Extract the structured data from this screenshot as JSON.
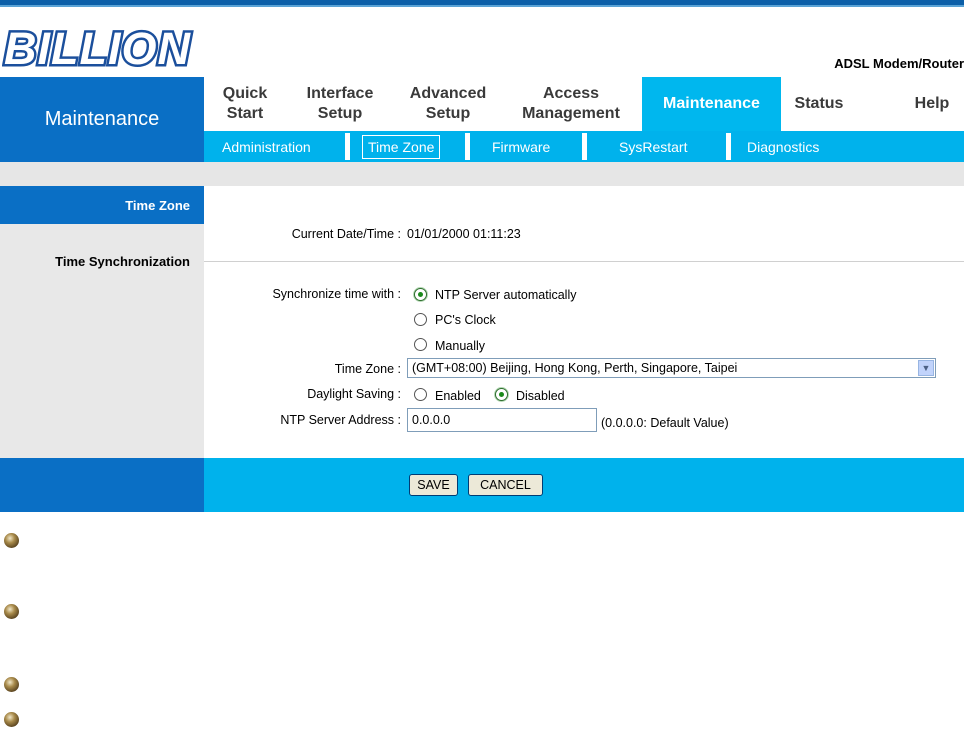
{
  "header": {
    "logo_text": "BILLION",
    "product": "ADSL Modem/Router"
  },
  "nav": {
    "section_title": "Maintenance",
    "items": [
      {
        "label": "Quick\nStart"
      },
      {
        "label": "Interface\nSetup"
      },
      {
        "label": "Advanced\nSetup"
      },
      {
        "label": "Access\nManagement"
      },
      {
        "label": "Maintenance"
      },
      {
        "label": "Status"
      },
      {
        "label": "Help"
      }
    ],
    "active": "Maintenance"
  },
  "subnav": {
    "items": [
      {
        "label": "Administration"
      },
      {
        "label": "Time Zone"
      },
      {
        "label": "Firmware"
      },
      {
        "label": "SysRestart"
      },
      {
        "label": "Diagnostics"
      }
    ],
    "active": "Time Zone"
  },
  "sidebar": {
    "time_zone": "Time Zone",
    "time_sync": "Time Synchronization"
  },
  "form": {
    "current_label": "Current Date/Time :",
    "current_value": "01/01/2000 01:11:23",
    "sync_label": "Synchronize time with :",
    "sync_options": [
      "NTP Server automatically",
      "PC's Clock",
      "Manually"
    ],
    "sync_selected": "NTP Server automatically",
    "tz_label": "Time Zone :",
    "tz_value": "(GMT+08:00) Beijing, Hong Kong, Perth, Singapore, Taipei",
    "dst_label": "Daylight Saving :",
    "dst_enabled": "Enabled",
    "dst_disabled": "Disabled",
    "dst_selected": "Disabled",
    "ntp_label": "NTP Server Address :",
    "ntp_value": "0.0.0.0",
    "ntp_hint": "(0.0.0.0: Default Value)"
  },
  "buttons": {
    "save": "SAVE",
    "cancel": "CANCEL"
  },
  "colors": {
    "nav_blue": "#0a6fc5",
    "cyan": "#00b2ec"
  }
}
